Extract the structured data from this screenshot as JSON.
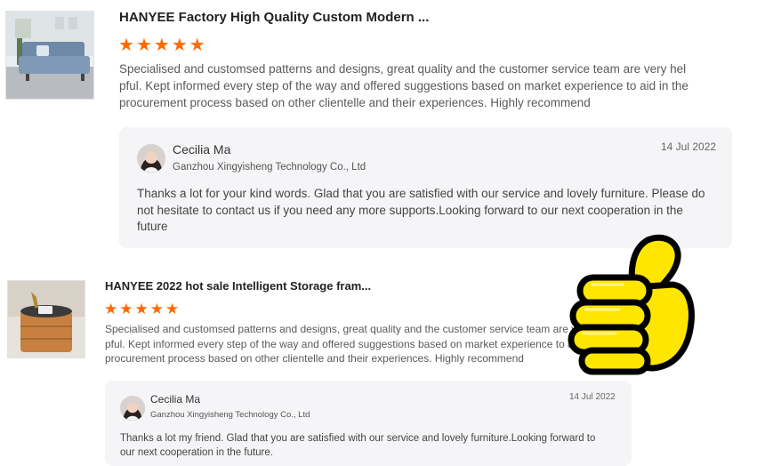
{
  "reviews": [
    {
      "product_title": "HANYEE Factory High Quality Custom Modern ...",
      "rating": 5,
      "review_lines": [
        "Specialised and customsed patterns and designs, great quality and the customer service team are very hel",
        "pful. Kept informed every step of the way and offered suggestions based on market experience to aid in the",
        "procurement process based on other clientelle and their experiences. Highly recommend"
      ],
      "reply": {
        "name": "Cecilia Ma",
        "company": "Ganzhou Xingyisheng Technology Co., Ltd",
        "date": "14 Jul 2022",
        "text_lines": [
          "Thanks a lot for your kind words. Glad that you are satisfied with our service and lovely furniture. Please do",
          "not hesitate to contact us if you need any more supports.Looking forward to our next cooperation in the",
          "future"
        ]
      }
    },
    {
      "product_title": "HANYEE 2022 hot sale Intelligent Storage fram...",
      "rating": 5,
      "review_lines": [
        "Specialised and customsed patterns and designs, great quality and the customer service team are very hel",
        "pful. Kept informed every step of the way and offered suggestions based on market experience to aid in the",
        "procurement process based on other clientelle and their experiences. Highly recommend"
      ],
      "reply": {
        "name": "Cecilia Ma",
        "company": "Ganzhou Xingyisheng Technology Co., Ltd",
        "date": "14 Jul 2022",
        "text_lines": [
          "Thanks a lot my friend. Glad that you are satisfied with our service and lovely furniture.Looking forward to",
          "our next cooperation in the future."
        ]
      }
    }
  ],
  "colors": {
    "star": "#ff6a00",
    "reply_bg": "#f5f5f7",
    "thumbs_up": "#ffe600"
  },
  "decoration": {
    "sticker_icon": "thumbs-up-icon"
  }
}
